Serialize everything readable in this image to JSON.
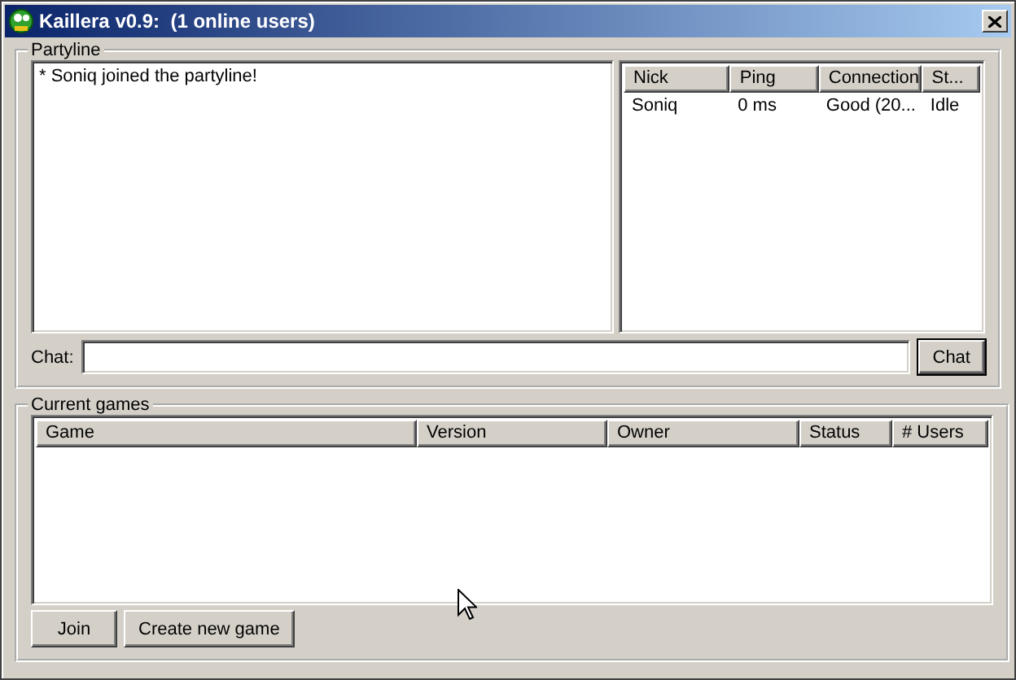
{
  "window": {
    "title": "Kaillera v0.9:  (1 online users)"
  },
  "partyline": {
    "legend": "Partyline",
    "messages": [
      "* Soniq joined the partyline!"
    ],
    "users": {
      "columns": [
        "Nick",
        "Ping",
        "Connection",
        "St..."
      ],
      "rows": [
        [
          "Soniq",
          "0 ms",
          "Good (20...",
          "Idle"
        ]
      ]
    },
    "chat": {
      "label": "Chat:",
      "button": "Chat"
    }
  },
  "games": {
    "legend": "Current games",
    "columns": [
      "Game",
      "Version",
      "Owner",
      "Status",
      "# Users"
    ],
    "buttons": [
      "Join",
      "Create new game"
    ]
  }
}
